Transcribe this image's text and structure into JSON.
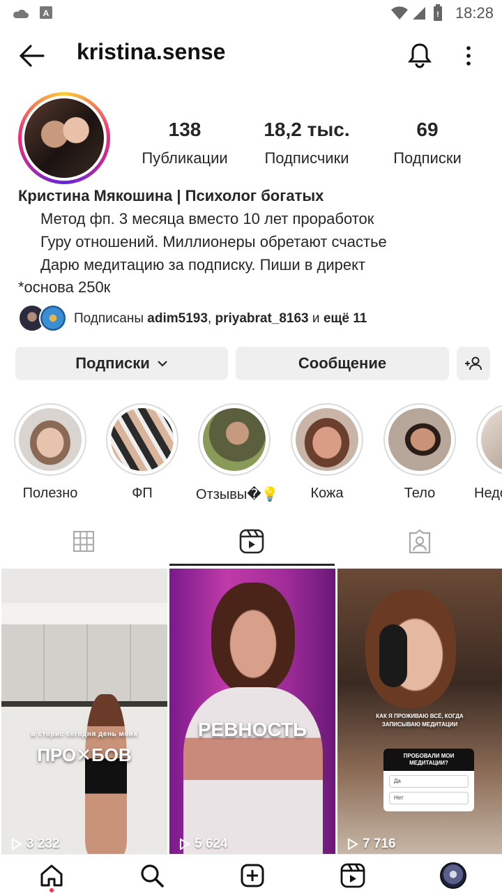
{
  "status_bar": {
    "time": "18:28"
  },
  "header": {
    "username": "kristina.sense"
  },
  "profile": {
    "stats": [
      {
        "value": "138",
        "label": "Публикации"
      },
      {
        "value": "18,2 тыс.",
        "label": "Подписчики"
      },
      {
        "value": "69",
        "label": "Подписки"
      }
    ],
    "name": "Кристина Мякошина | Психолог богатых",
    "bio_lines": [
      "Метод фп. 3 месяца вместо 10 лет проработок",
      "Гуру отношений. Миллионеры обретают счастье",
      "Дарю медитацию за подписку. Пиши в директ",
      "*основа 250к"
    ],
    "mutual": {
      "prefix": "Подписаны ",
      "user1": "adim5193",
      "sep": ", ",
      "user2": "priyabrat_8163",
      "and": " и ",
      "more": "ещё 11"
    }
  },
  "actions": {
    "following": "Подписки",
    "message": "Сообщение"
  },
  "highlights": [
    {
      "label": "Полезно"
    },
    {
      "label": "ФП"
    },
    {
      "label": "Отзывы�💡"
    },
    {
      "label": "Кожа"
    },
    {
      "label": "Тело"
    },
    {
      "label": "Недо"
    }
  ],
  "reels": [
    {
      "views": "3 232",
      "caption": "ПРО✕БОВ",
      "subcaption": "в сторис сегодня день моих"
    },
    {
      "views": "5 624",
      "caption": "РЕВНОСТЬ"
    },
    {
      "views": "7 716",
      "caption": "КАК Я ПРОЖИВАЮ ВСЁ, КОГДА ЗАПИСЫВАЮ МЕДИТАЦИИ",
      "poll_title": "ПРОБОВАЛИ МОИ МЕДИТАЦИИ?",
      "poll_yes": "Да",
      "poll_no": "Нет"
    }
  ]
}
